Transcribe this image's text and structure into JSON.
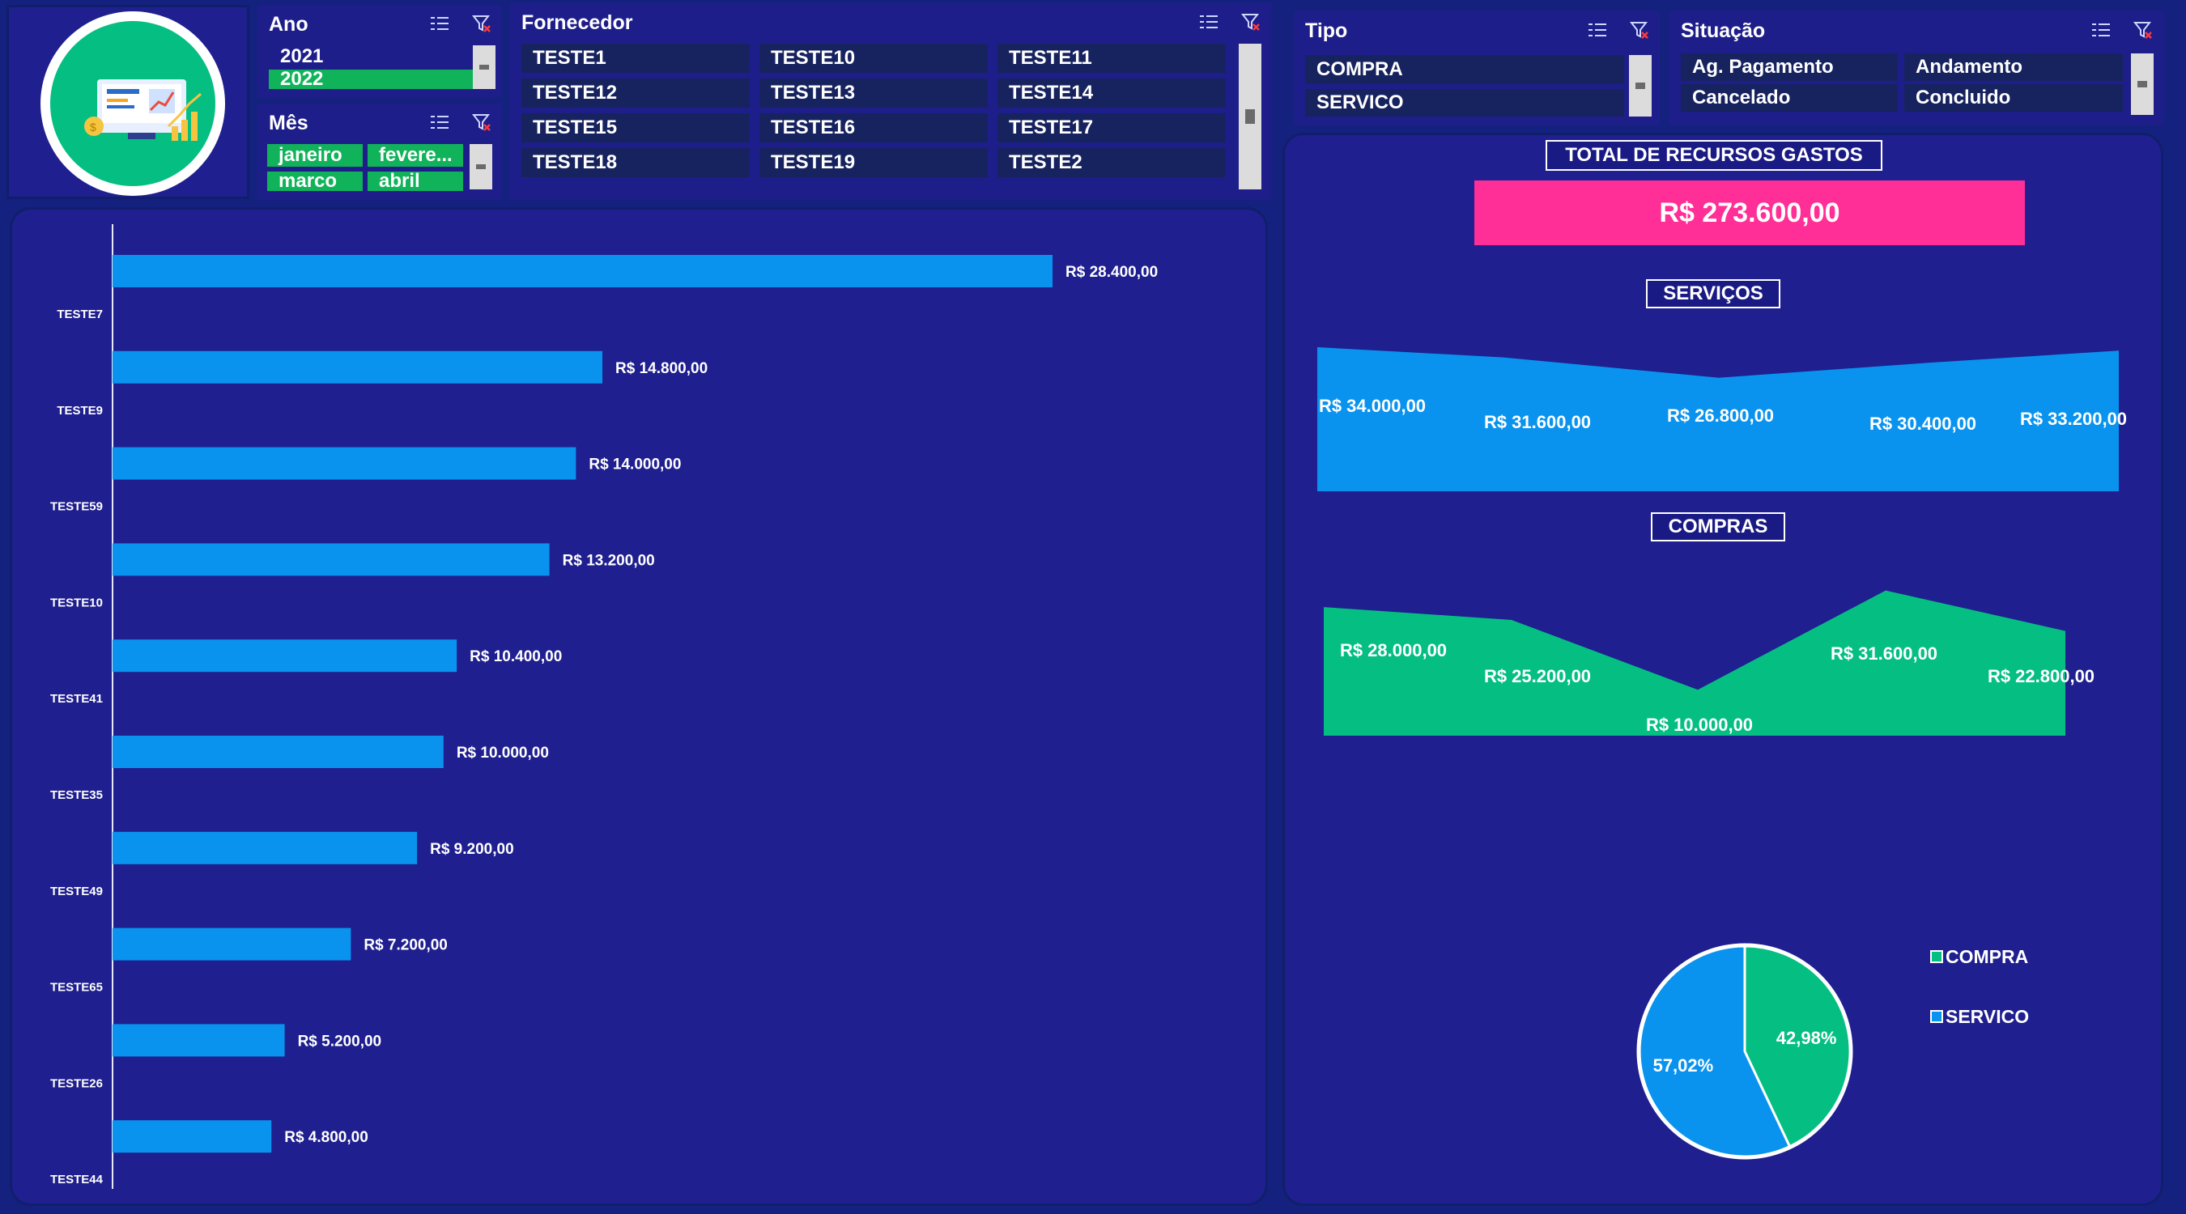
{
  "slicers": {
    "ano": {
      "title": "Ano",
      "items": [
        "2021",
        "2022"
      ]
    },
    "mes": {
      "title": "Mês",
      "items": [
        "janeiro",
        "fevere...",
        "marco",
        "abril"
      ]
    },
    "fornecedor": {
      "title": "Fornecedor",
      "items": [
        "TESTE1",
        "TESTE10",
        "TESTE11",
        "TESTE12",
        "TESTE13",
        "TESTE14",
        "TESTE15",
        "TESTE16",
        "TESTE17",
        "TESTE18",
        "TESTE19",
        "TESTE2"
      ]
    },
    "tipo": {
      "title": "Tipo",
      "items": [
        "COMPRA",
        "SERVICO"
      ]
    },
    "situacao": {
      "title": "Situação",
      "items": [
        "Ag. Pagamento",
        "Andamento",
        "Cancelado",
        "Concluido"
      ]
    }
  },
  "summary": {
    "total_title": "TOTAL DE RECURSOS GASTOS",
    "total_value": "R$ 273.600,00",
    "servicos_title": "SERVIÇOS",
    "compras_title": "COMPRAS"
  },
  "colors": {
    "background": "#15217f",
    "panel": "#1f1f8f",
    "bar_blue": "#0a93ee",
    "area_green": "#05bf82",
    "total_pink": "#ff2f97",
    "selected_green": "#11b35a"
  },
  "chart_data": [
    {
      "type": "bar",
      "orientation": "horizontal",
      "categories": [
        "TESTE7",
        "TESTE9",
        "TESTE59",
        "TESTE10",
        "TESTE41",
        "TESTE35",
        "TESTE49",
        "TESTE65",
        "TESTE26",
        "TESTE44"
      ],
      "values": [
        28400,
        14800,
        14000,
        13200,
        10400,
        10000,
        9200,
        7200,
        5200,
        4800
      ],
      "data_labels": [
        "R$ 28.400,00",
        "R$ 14.800,00",
        "R$ 14.000,00",
        "R$ 13.200,00",
        "R$ 10.400,00",
        "R$ 10.000,00",
        "R$ 9.200,00",
        "R$ 7.200,00",
        "R$ 5.200,00",
        "R$ 4.800,00"
      ],
      "xlim": [
        0,
        34000
      ]
    },
    {
      "type": "area",
      "title": "SERVIÇOS",
      "values": [
        34000,
        31600,
        26800,
        30400,
        33200
      ],
      "data_labels": [
        "R$ 34.000,00",
        "R$ 31.600,00",
        "R$ 26.800,00",
        "R$ 30.400,00",
        "R$ 33.200,00"
      ],
      "ylim": [
        0,
        34000
      ]
    },
    {
      "type": "area",
      "title": "COMPRAS",
      "values": [
        28000,
        25200,
        10000,
        31600,
        22800
      ],
      "data_labels": [
        "R$ 28.000,00",
        "R$ 25.200,00",
        "R$ 10.000,00",
        "R$ 31.600,00",
        "R$ 22.800,00"
      ],
      "ylim": [
        0,
        34000
      ]
    },
    {
      "type": "pie",
      "labels": [
        "COMPRA",
        "SERVICO"
      ],
      "values": [
        42.98,
        57.02
      ],
      "data_labels": [
        "42,98%",
        "57,02%"
      ],
      "colors": [
        "#05bf82",
        "#0a93ee"
      ],
      "legend": "right"
    }
  ]
}
